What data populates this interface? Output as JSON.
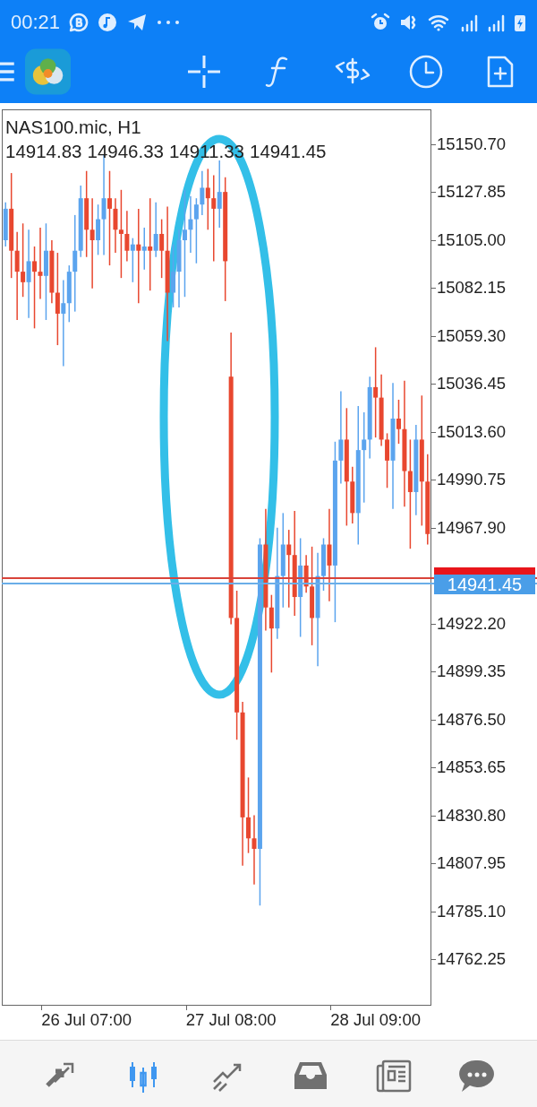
{
  "status_bar": {
    "time": "00:21"
  },
  "chart": {
    "symbol": "NAS100.mic, H1",
    "ohlc": [
      "14914.83",
      "14946.33",
      "14911.33",
      "14941.45"
    ],
    "price_label": "14941.45",
    "chart_data": {
      "type": "candlestick",
      "ylim": [
        14740.68,
        15166.93
      ],
      "ref_lines": [
        {
          "axis": "y",
          "value": 14944.0,
          "color": "#d9443a"
        },
        {
          "axis": "y",
          "value": 14941.45,
          "color": "#6aaee8"
        }
      ],
      "categories": [
        null,
        null,
        null,
        null,
        null,
        null,
        null,
        null,
        null,
        null,
        null,
        null,
        null,
        null,
        "26 Jul 07:00",
        null,
        null,
        null,
        null,
        null,
        null,
        null,
        null,
        null,
        null,
        null,
        null,
        null,
        null,
        null,
        null,
        null,
        null,
        null,
        null,
        null,
        null,
        null,
        null,
        "27 Jul 08:00",
        null,
        null,
        null,
        null,
        null,
        null,
        null,
        null,
        null,
        null,
        null,
        null,
        null,
        null,
        null,
        null,
        null,
        null,
        null,
        null,
        null,
        null,
        null,
        null,
        "28 Jul 09:00",
        null,
        null,
        null,
        null,
        null,
        null,
        null,
        null,
        null
      ],
      "ohlc": [
        [
          15105,
          15123,
          15102,
          15120
        ],
        [
          15120,
          15137,
          15087,
          15100
        ],
        [
          15100,
          15109,
          15067,
          15090
        ],
        [
          15090,
          15113,
          15078,
          15085
        ],
        [
          15085,
          15110,
          15068,
          15095
        ],
        [
          15095,
          15102,
          15063,
          15090
        ],
        [
          15090,
          15111,
          15077,
          15088
        ],
        [
          15088,
          15113,
          15067,
          15100
        ],
        [
          15100,
          15105,
          15075,
          15080
        ],
        [
          15080,
          15099,
          15055,
          15070
        ],
        [
          15070,
          15086,
          15045,
          15075
        ],
        [
          15075,
          15093,
          15066,
          15090
        ],
        [
          15090,
          15117,
          15071,
          15100
        ],
        [
          15100,
          15131,
          15097,
          15125
        ],
        [
          15125,
          15138,
          15097,
          15110
        ],
        [
          15110,
          15125,
          15082,
          15105
        ],
        [
          15105,
          15122,
          15098,
          15115
        ],
        [
          15115,
          15146,
          15098,
          15125
        ],
        [
          15125,
          15138,
          15093,
          15120
        ],
        [
          15120,
          15125,
          15099,
          15110
        ],
        [
          15110,
          15129,
          15087,
          15108
        ],
        [
          15108,
          15119,
          15095,
          15100
        ],
        [
          15100,
          15106,
          15085,
          15103
        ],
        [
          15103,
          15120,
          15075,
          15100
        ],
        [
          15100,
          15111,
          15091,
          15102
        ],
        [
          15102,
          15125,
          15081,
          15100
        ],
        [
          15100,
          15123,
          15097,
          15108
        ],
        [
          15108,
          15115,
          15087,
          15100
        ],
        [
          15100,
          15121,
          15057,
          15080
        ],
        [
          15080,
          15103,
          15073,
          15090
        ],
        [
          15090,
          15110,
          15073,
          15105
        ],
        [
          15105,
          15129,
          15078,
          15110
        ],
        [
          15110,
          15126,
          15099,
          15115
        ],
        [
          15115,
          15125,
          15094,
          15122
        ],
        [
          15122,
          15138,
          15117,
          15130
        ],
        [
          15130,
          15139,
          15110,
          15125
        ],
        [
          15125,
          15136,
          15095,
          15120
        ],
        [
          15120,
          15143,
          15111,
          15128
        ],
        [
          15128,
          15135,
          15076,
          15095
        ],
        [
          15040,
          15061,
          14922,
          14925
        ],
        [
          14925,
          14938,
          14867,
          14880
        ],
        [
          14880,
          14885,
          14807,
          14830
        ],
        [
          14830,
          14849,
          14813,
          14820
        ],
        [
          14820,
          14831,
          14798,
          14815
        ],
        [
          14815,
          14963,
          14788,
          14960
        ],
        [
          14960,
          14977,
          14919,
          14930
        ],
        [
          14930,
          14936,
          14899,
          14920
        ],
        [
          14920,
          14968,
          14915,
          14945
        ],
        [
          14945,
          14975,
          14930,
          14960
        ],
        [
          14960,
          14967,
          14930,
          14955
        ],
        [
          14955,
          14976,
          14926,
          14935
        ],
        [
          14935,
          14963,
          14916,
          14950
        ],
        [
          14950,
          14955,
          14937,
          14940
        ],
        [
          14940,
          14959,
          14912,
          14925
        ],
        [
          14925,
          14956,
          14902,
          14945
        ],
        [
          14945,
          14963,
          14938,
          14960
        ],
        [
          14960,
          14977,
          14933,
          14950
        ],
        [
          14950,
          15009,
          14923,
          15000
        ],
        [
          15000,
          15033,
          14989,
          15010
        ],
        [
          15010,
          15025,
          14969,
          14990
        ],
        [
          14990,
          14997,
          14970,
          14975
        ],
        [
          14975,
          15026,
          14960,
          15005
        ],
        [
          15005,
          15023,
          14980,
          15010
        ],
        [
          15010,
          15040,
          15001,
          15035
        ],
        [
          15035,
          15054,
          15011,
          15030
        ],
        [
          15030,
          15041,
          15007,
          15010
        ],
        [
          15010,
          15013,
          14987,
          15000
        ],
        [
          15000,
          15037,
          14977,
          15020
        ],
        [
          15020,
          15029,
          15008,
          15015
        ],
        [
          15015,
          15038,
          14978,
          14995
        ],
        [
          14995,
          15010,
          14958,
          14985
        ],
        [
          14985,
          15017,
          14974,
          15010
        ],
        [
          15010,
          15031,
          14969,
          14990
        ],
        [
          14990,
          15003,
          14960,
          14965
        ]
      ],
      "yticks": [
        {
          "value": 15150.7,
          "label": "15150.70"
        },
        {
          "value": 15127.85,
          "label": "15127.85"
        },
        {
          "value": 15105.0,
          "label": "15105.00"
        },
        {
          "value": 15082.15,
          "label": "15082.15"
        },
        {
          "value": 15059.3,
          "label": "15059.30"
        },
        {
          "value": 15036.45,
          "label": "15036.45"
        },
        {
          "value": 15013.6,
          "label": "15013.60"
        },
        {
          "value": 14990.75,
          "label": "14990.75"
        },
        {
          "value": 14967.9,
          "label": "14967.90"
        },
        {
          "value": 14922.2,
          "label": "14922.20"
        },
        {
          "value": 14899.35,
          "label": "14899.35"
        },
        {
          "value": 14876.5,
          "label": "14876.50"
        },
        {
          "value": 14853.65,
          "label": "14853.65"
        },
        {
          "value": 14830.8,
          "label": "14830.80"
        },
        {
          "value": 14807.95,
          "label": "14807.95"
        },
        {
          "value": 14785.1,
          "label": "14785.10"
        },
        {
          "value": 14762.25,
          "label": "14762.25"
        }
      ]
    }
  },
  "bottom_nav": [
    {
      "kind": "trade",
      "selected": false
    },
    {
      "kind": "chart",
      "selected": true
    },
    {
      "kind": "signals",
      "selected": false
    },
    {
      "kind": "history",
      "selected": false
    },
    {
      "kind": "news",
      "selected": false
    },
    {
      "kind": "chat",
      "selected": false
    }
  ]
}
